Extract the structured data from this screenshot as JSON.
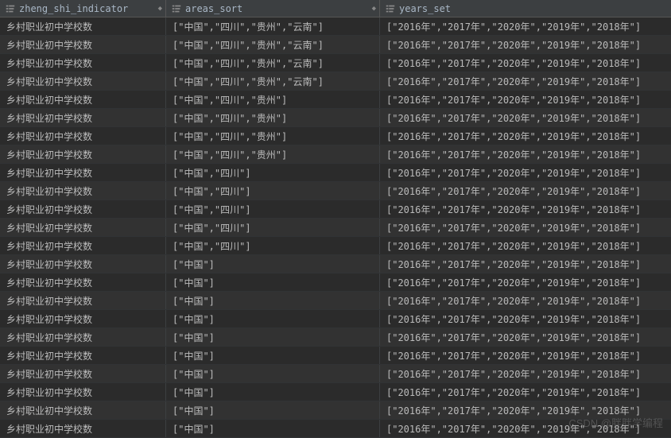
{
  "columns": {
    "col1": {
      "name": "zheng_shi_indicator"
    },
    "col2": {
      "name": "areas_sort"
    },
    "col3": {
      "name": "years_set"
    }
  },
  "watermark": "CSDN @胖胖学编程",
  "rows": [
    {
      "indicator": "乡村职业初中学校数",
      "areas": "[\"中国\",\"四川\",\"贵州\",\"云南\"]",
      "years": "[\"2016年\",\"2017年\",\"2020年\",\"2019年\",\"2018年\"]"
    },
    {
      "indicator": "乡村职业初中学校数",
      "areas": "[\"中国\",\"四川\",\"贵州\",\"云南\"]",
      "years": "[\"2016年\",\"2017年\",\"2020年\",\"2019年\",\"2018年\"]"
    },
    {
      "indicator": "乡村职业初中学校数",
      "areas": "[\"中国\",\"四川\",\"贵州\",\"云南\"]",
      "years": "[\"2016年\",\"2017年\",\"2020年\",\"2019年\",\"2018年\"]"
    },
    {
      "indicator": "乡村职业初中学校数",
      "areas": "[\"中国\",\"四川\",\"贵州\",\"云南\"]",
      "years": "[\"2016年\",\"2017年\",\"2020年\",\"2019年\",\"2018年\"]"
    },
    {
      "indicator": "乡村职业初中学校数",
      "areas": "[\"中国\",\"四川\",\"贵州\"]",
      "years": "[\"2016年\",\"2017年\",\"2020年\",\"2019年\",\"2018年\"]"
    },
    {
      "indicator": "乡村职业初中学校数",
      "areas": "[\"中国\",\"四川\",\"贵州\"]",
      "years": "[\"2016年\",\"2017年\",\"2020年\",\"2019年\",\"2018年\"]"
    },
    {
      "indicator": "乡村职业初中学校数",
      "areas": "[\"中国\",\"四川\",\"贵州\"]",
      "years": "[\"2016年\",\"2017年\",\"2020年\",\"2019年\",\"2018年\"]"
    },
    {
      "indicator": "乡村职业初中学校数",
      "areas": "[\"中国\",\"四川\",\"贵州\"]",
      "years": "[\"2016年\",\"2017年\",\"2020年\",\"2019年\",\"2018年\"]"
    },
    {
      "indicator": "乡村职业初中学校数",
      "areas": "[\"中国\",\"四川\"]",
      "years": "[\"2016年\",\"2017年\",\"2020年\",\"2019年\",\"2018年\"]"
    },
    {
      "indicator": "乡村职业初中学校数",
      "areas": "[\"中国\",\"四川\"]",
      "years": "[\"2016年\",\"2017年\",\"2020年\",\"2019年\",\"2018年\"]"
    },
    {
      "indicator": "乡村职业初中学校数",
      "areas": "[\"中国\",\"四川\"]",
      "years": "[\"2016年\",\"2017年\",\"2020年\",\"2019年\",\"2018年\"]"
    },
    {
      "indicator": "乡村职业初中学校数",
      "areas": "[\"中国\",\"四川\"]",
      "years": "[\"2016年\",\"2017年\",\"2020年\",\"2019年\",\"2018年\"]"
    },
    {
      "indicator": "乡村职业初中学校数",
      "areas": "[\"中国\",\"四川\"]",
      "years": "[\"2016年\",\"2017年\",\"2020年\",\"2019年\",\"2018年\"]"
    },
    {
      "indicator": "乡村职业初中学校数",
      "areas": "[\"中国\"]",
      "years": "[\"2016年\",\"2017年\",\"2020年\",\"2019年\",\"2018年\"]"
    },
    {
      "indicator": "乡村职业初中学校数",
      "areas": "[\"中国\"]",
      "years": "[\"2016年\",\"2017年\",\"2020年\",\"2019年\",\"2018年\"]"
    },
    {
      "indicator": "乡村职业初中学校数",
      "areas": "[\"中国\"]",
      "years": "[\"2016年\",\"2017年\",\"2020年\",\"2019年\",\"2018年\"]"
    },
    {
      "indicator": "乡村职业初中学校数",
      "areas": "[\"中国\"]",
      "years": "[\"2016年\",\"2017年\",\"2020年\",\"2019年\",\"2018年\"]"
    },
    {
      "indicator": "乡村职业初中学校数",
      "areas": "[\"中国\"]",
      "years": "[\"2016年\",\"2017年\",\"2020年\",\"2019年\",\"2018年\"]"
    },
    {
      "indicator": "乡村职业初中学校数",
      "areas": "[\"中国\"]",
      "years": "[\"2016年\",\"2017年\",\"2020年\",\"2019年\",\"2018年\"]"
    },
    {
      "indicator": "乡村职业初中学校数",
      "areas": "[\"中国\"]",
      "years": "[\"2016年\",\"2017年\",\"2020年\",\"2019年\",\"2018年\"]"
    },
    {
      "indicator": "乡村职业初中学校数",
      "areas": "[\"中国\"]",
      "years": "[\"2016年\",\"2017年\",\"2020年\",\"2019年\",\"2018年\"]"
    },
    {
      "indicator": "乡村职业初中学校数",
      "areas": "[\"中国\"]",
      "years": "[\"2016年\",\"2017年\",\"2020年\",\"2019年\",\"2018年\"]"
    },
    {
      "indicator": "乡村职业初中学校数",
      "areas": "[\"中国\"]",
      "years": "[\"2016年\",\"2017年\",\"2020年\",\"2019年\",\"2018年\"]"
    }
  ]
}
